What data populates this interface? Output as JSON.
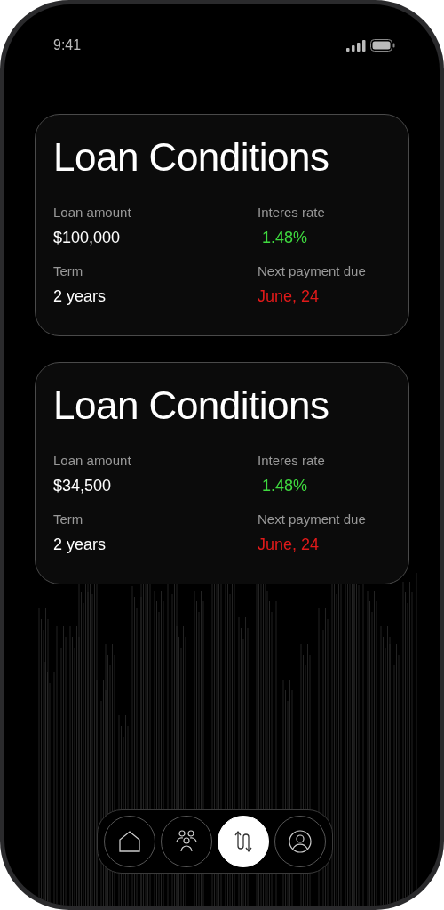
{
  "status_bar": {
    "time": "9:41"
  },
  "cards": [
    {
      "title": "Loan Conditions",
      "fields": [
        {
          "label": "Loan amount",
          "value": "$100,000",
          "color": "#ffffff"
        },
        {
          "label": "Interes rate",
          "value": " 1.48%",
          "color": "#3fd93f"
        },
        {
          "label": "Term",
          "value": "2 years",
          "color": "#ffffff"
        },
        {
          "label": "Next payment due",
          "value": "June, 24",
          "color": "#e01a1a"
        }
      ]
    },
    {
      "title": "Loan Conditions",
      "fields": [
        {
          "label": "Loan amount",
          "value": "$34,500",
          "color": "#ffffff"
        },
        {
          "label": "Interes rate",
          "value": " 1.48%",
          "color": "#3fd93f"
        },
        {
          "label": "Term",
          "value": "2 years",
          "color": "#ffffff"
        },
        {
          "label": "Next payment due",
          "value": "June, 24",
          "color": "#e01a1a"
        }
      ]
    }
  ],
  "nav": [
    {
      "selected": false
    },
    {
      "selected": false
    },
    {
      "selected": true
    },
    {
      "selected": false
    }
  ]
}
